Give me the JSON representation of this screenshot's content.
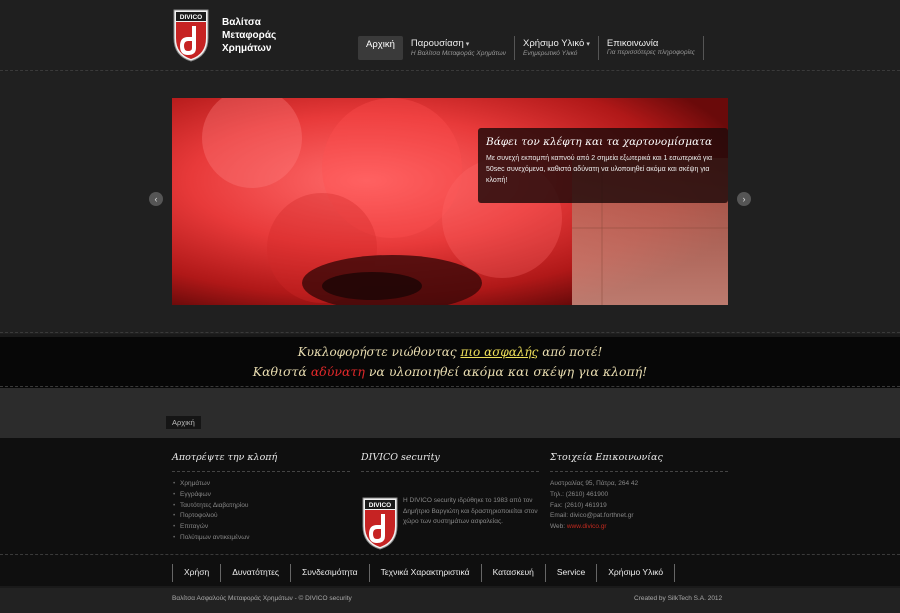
{
  "header": {
    "brand_lines": [
      "Βαλίτσα",
      "Μεταφοράς",
      "Χρημάτων"
    ],
    "logo_text": "DIVICO"
  },
  "nav": {
    "items": [
      {
        "label": "Αρχική",
        "sub": "",
        "caret": false
      },
      {
        "label": "Παρουσίαση",
        "sub": "Η Βαλίτσα Μεταφοράς Χρημάτων",
        "caret": true
      },
      {
        "label": "Χρήσιμο Υλικό",
        "sub": "Ενημερωτικό Υλικό",
        "caret": true
      },
      {
        "label": "Επικοινωνία",
        "sub": "Για περισσότερες πληροφορίες",
        "caret": false
      }
    ]
  },
  "slider": {
    "caption_title": "Βάφει τον κλέφτη και τα χαρτονομίσματα",
    "caption_text": "Με συνεχή εκπομπή καπνού από 2 σημεία εξωτερικά και 1 εσωτερικά για 50sec συνεχόμενα, καθιστά αδύνατη να υλοποιηθεί ακόμα και σκέψη για κλοπή!",
    "prev_icon": "‹",
    "next_icon": "›"
  },
  "tagline": {
    "line1_before": "Κυκλοφορήστε νιώθοντας ",
    "line1_highlight": "πιο ασφαλής",
    "line1_after": " από ποτέ!",
    "line2_before": "Καθιστά ",
    "line2_highlight": "αδύνατη",
    "line2_after": " να υλοποιηθεί ακόμα και σκέψη για κλοπή!"
  },
  "breadcrumb": {
    "label": "Αρχική"
  },
  "footer": {
    "col1": {
      "title": "Αποτρέψτε την κλοπή",
      "items": [
        "Χρημάτων",
        "Εγγράφων",
        "Ταυτότητες Διαβατηρίου",
        "Πορτοφολιού",
        "Επιταγών",
        "Πολύτιμων αντικειμένων"
      ]
    },
    "col2": {
      "title": "DIVICO security",
      "text": "Η DIVICO security ιδρύθηκε το 1983 από τον Δημήτριο Βαργιώτη και δραστηριοποιείται στον χώρο των συστημάτων ασφαλείας."
    },
    "col3": {
      "title": "Στοιχεία Επικοινωνίας",
      "address": "Αυστραλίας 95, Πάτρα, 264 42",
      "phone": "Τηλ.: (2610) 461900",
      "fax": "Fax: (2610) 461919",
      "email": "Email: divico@pat.forthnet.gr",
      "web_label": "Web: ",
      "web": "www.divico.gr"
    }
  },
  "bottom_nav": {
    "items": [
      "Χρήση",
      "Δυνατότητες",
      "Συνδεσιμότητα",
      "Τεχνικά Χαρακτηριστικά",
      "Κατασκευή",
      "Service",
      "Χρήσιμο Υλικό"
    ]
  },
  "copyright": {
    "left": "Βαλίτσα Ασφαλούς Μεταφοράς Χρημάτων - © DIVICO security",
    "right": "Created by SilkTech S.A. 2012"
  },
  "colors": {
    "accent_red": "#c42a1f",
    "highlight_yellow": "#f0e05a",
    "background": "#1a1a1a"
  }
}
